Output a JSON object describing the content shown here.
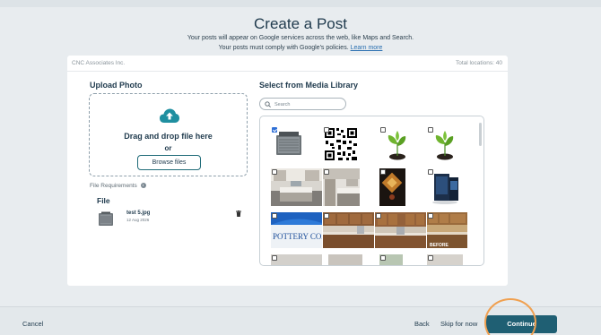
{
  "page": {
    "title": "Create a Post",
    "subtitle_line1": "Your posts will appear on Google services across the web, like Maps and Search.",
    "subtitle_line2": "Your posts must comply with Google's policies.",
    "learn_more": "Learn more"
  },
  "panel": {
    "company": "CNC Associates Inc.",
    "total_locations": "Total locations: 40"
  },
  "upload": {
    "title": "Upload Photo",
    "drag_text": "Drag and drop file here",
    "or_text": "or",
    "browse_label": "Browse files",
    "requirements_label": "File Requirements",
    "file_header": "File",
    "file_name": "test 5.jpg",
    "file_date": "12 Aug 2026"
  },
  "library": {
    "title": "Select from Media Library",
    "search_placeholder": "Search",
    "banner_text": "POTTERY COAS",
    "before_label": "BEFORE",
    "items": [
      {
        "name": "ac-unit",
        "checked": true
      },
      {
        "name": "qr-code",
        "checked": false
      },
      {
        "name": "plant-sprout-1",
        "checked": false
      },
      {
        "name": "plant-sprout-2",
        "checked": false
      },
      {
        "name": "kitchen-1",
        "checked": false
      },
      {
        "name": "kitchen-2",
        "checked": false
      },
      {
        "name": "food-art",
        "checked": false
      },
      {
        "name": "display-stand",
        "checked": false
      },
      {
        "name": "store-banner",
        "checked": false
      },
      {
        "name": "kitchen-cabinets-1",
        "checked": false
      },
      {
        "name": "kitchen-cabinets-2",
        "checked": false
      },
      {
        "name": "kitchen-before",
        "checked": false
      }
    ]
  },
  "footer": {
    "cancel": "Cancel",
    "back": "Back",
    "skip": "Skip for now",
    "continue": "Continue"
  },
  "colors": {
    "primary": "#1f5f73",
    "accent_teal": "#1f8fa0",
    "highlight": "#f0a050",
    "checkbox_blue": "#2e6fd6"
  }
}
